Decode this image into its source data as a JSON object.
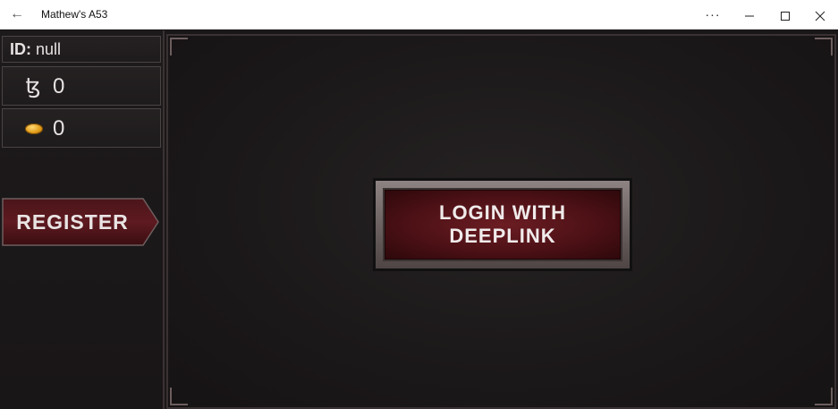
{
  "window": {
    "title": "Mathew's A53",
    "more_label": "···",
    "minimize_label": "—",
    "maximize_label": "☐",
    "close_label": "✕"
  },
  "sidebar": {
    "id_label": "ID:",
    "id_value": "null",
    "tez_balance": "0",
    "coin_balance": "0",
    "register_label": "REGISTER"
  },
  "main": {
    "login_line1": "LOGIN WITH",
    "login_line2": "DEEPLINK"
  },
  "icons": {
    "back": "back-arrow-icon",
    "tez": "tezos-icon",
    "coin": "coin-icon"
  },
  "colors": {
    "accent": "#5a1419",
    "background": "#1a1718",
    "text": "#e6e2e2"
  }
}
